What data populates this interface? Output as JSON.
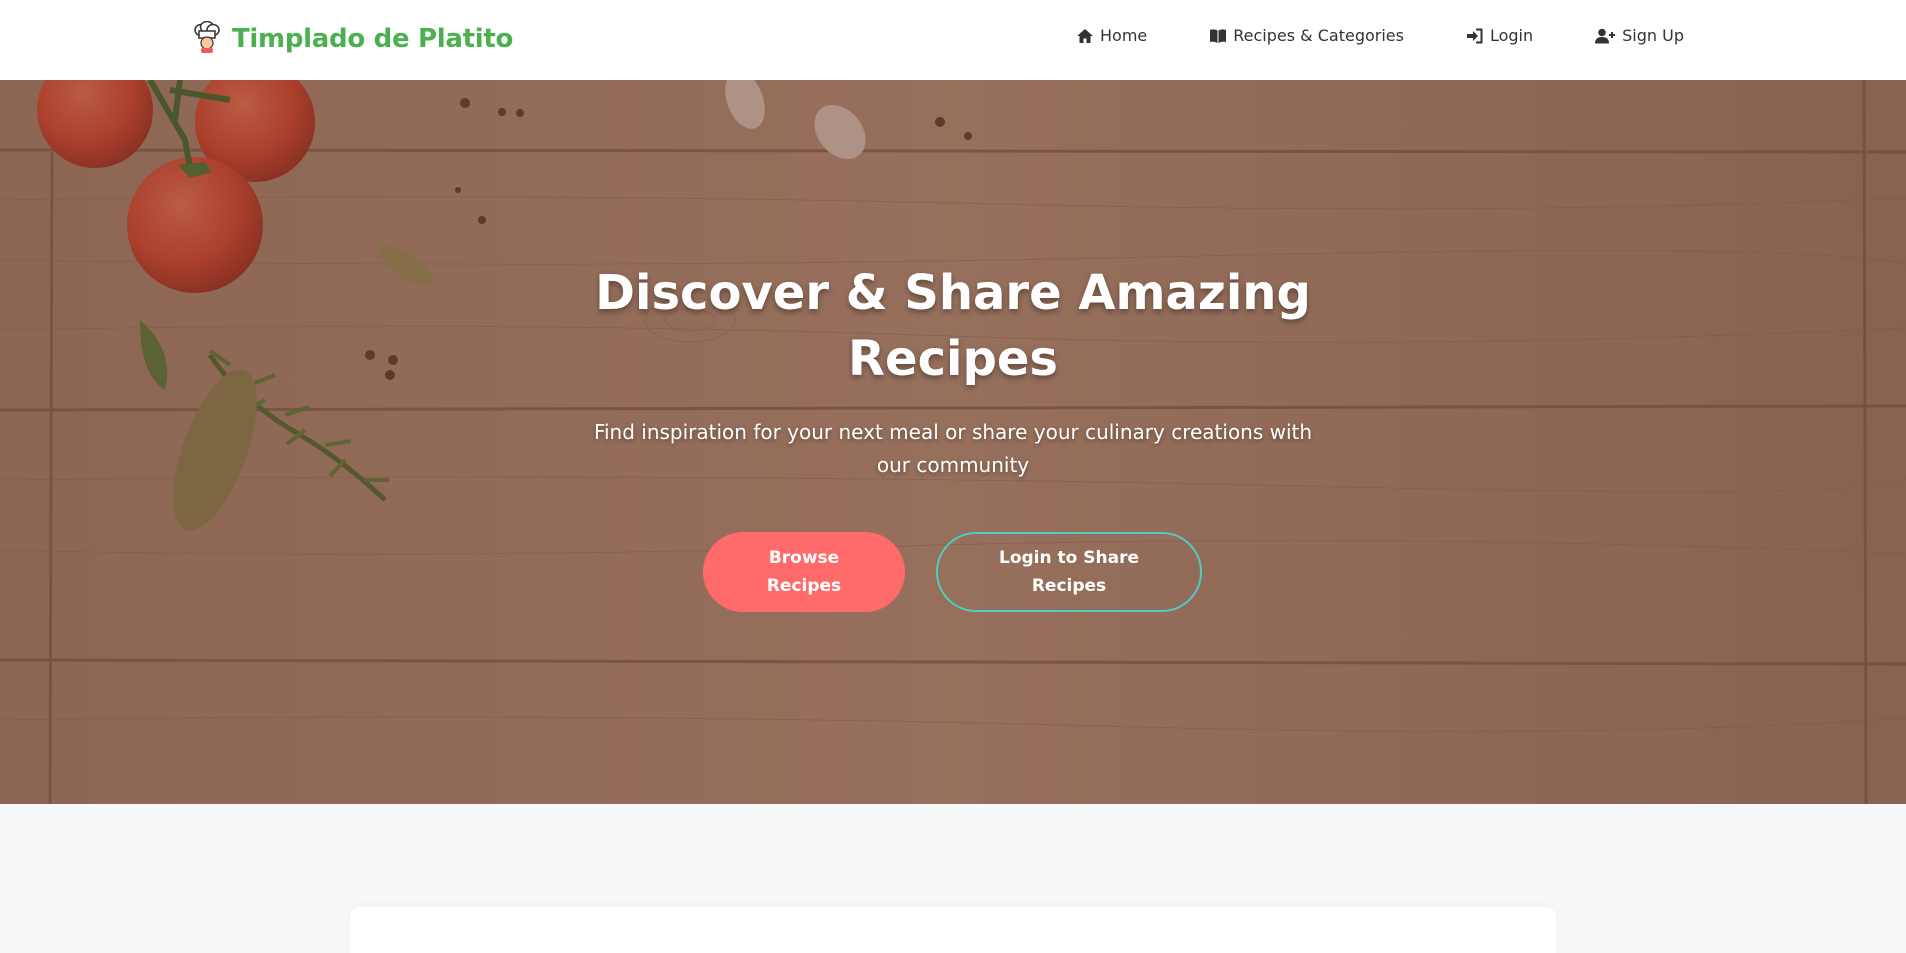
{
  "header": {
    "brand": "Timplado de Platito",
    "brand_icon": "chef-icon",
    "nav": [
      {
        "label": "Home",
        "icon": "home-icon"
      },
      {
        "label": "Recipes & Categories",
        "icon": "book-icon"
      },
      {
        "label": "Login",
        "icon": "login-icon"
      },
      {
        "label": "Sign Up",
        "icon": "user-plus-icon"
      }
    ]
  },
  "hero": {
    "title": "Discover & Share Amazing Recipes",
    "subtitle": "Find inspiration for your next meal or share your culinary creations with our community",
    "browse_button": "Browse Recipes",
    "login_share_button": "Login to Share Recipes"
  },
  "colors": {
    "brand": "#4caf50",
    "primary_button": "#ff6b6b",
    "secondary_border": "#4ecdc4",
    "page_bg": "#f7f8fa"
  }
}
